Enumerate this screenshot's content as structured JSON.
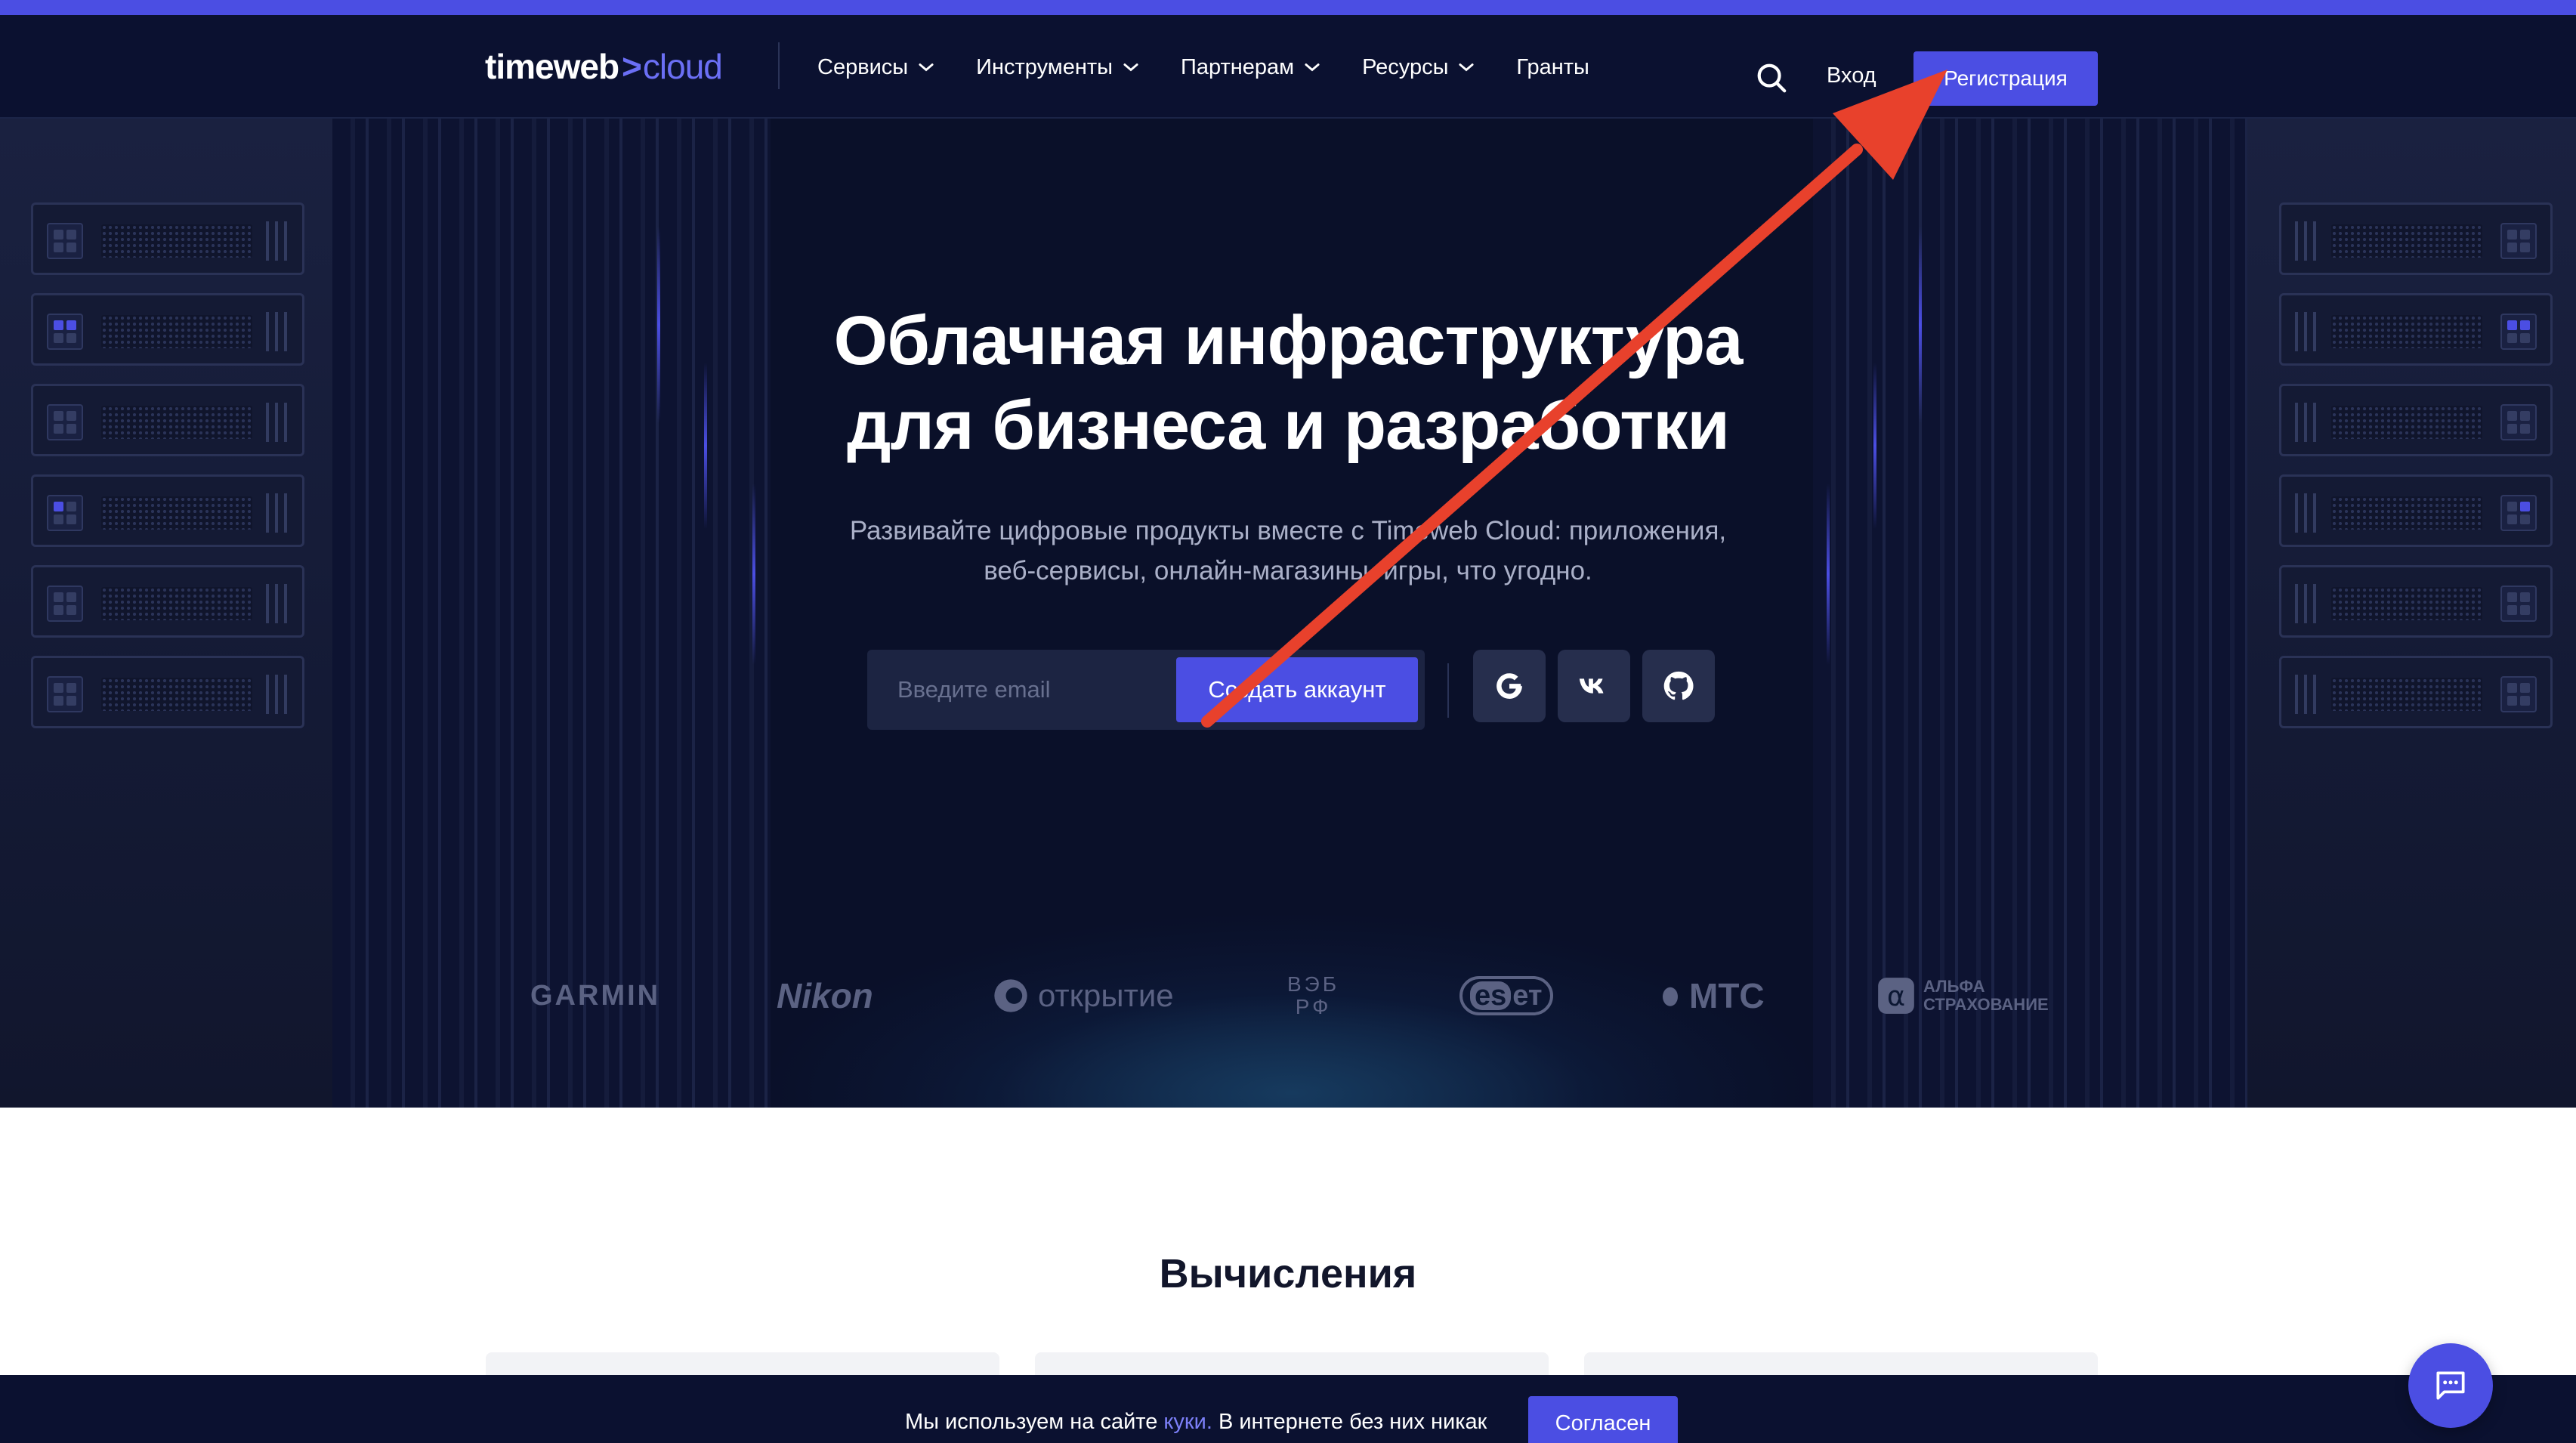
{
  "header": {
    "logo_main": "timeweb",
    "logo_caret": ">",
    "logo_cloud": "cloud",
    "menu": [
      {
        "label": "Сервисы",
        "has_dropdown": true
      },
      {
        "label": "Инструменты",
        "has_dropdown": true
      },
      {
        "label": "Партнерам",
        "has_dropdown": true
      },
      {
        "label": "Ресурсы",
        "has_dropdown": true
      },
      {
        "label": "Гранты",
        "has_dropdown": false
      }
    ],
    "search_icon": "search-icon",
    "login_label": "Вход",
    "register_label": "Регистрация"
  },
  "hero": {
    "title_line1": "Облачная инфраструктура",
    "title_line2": "для бизнеса и разработки",
    "subtitle_line1": "Развивайте цифровые продукты вместе с Timeweb Cloud: приложения,",
    "subtitle_line2": "веб-сервисы, онлайн-магазины, игры, что угодно.",
    "email_placeholder": "Введите email",
    "create_button": "Создать аккаунт",
    "social": [
      "google-icon",
      "vk-icon",
      "github-icon"
    ]
  },
  "partners": {
    "garmin": "GARMIN",
    "nikon": "Nikon",
    "otkrytie": "открытие",
    "veb_line1": "ВЭБ",
    "veb_line2": "РФ",
    "eset_e": "es",
    "eset_t": "ет",
    "mts": "МТС",
    "alfa_line1": "АЛЬФА",
    "alfa_line2": "СТРАХОВАНИЕ"
  },
  "section": {
    "title": "Вычисления"
  },
  "cookie": {
    "text_before": "Мы используем на сайте ",
    "link": "куки.",
    "text_after": " В интернете без них никак",
    "agree_label": "Согласен"
  },
  "colors": {
    "accent": "#4b4ee3",
    "hero_bg": "#0a1029",
    "annotation_arrow": "#e8412c"
  },
  "chat_icon": "chat-icon"
}
